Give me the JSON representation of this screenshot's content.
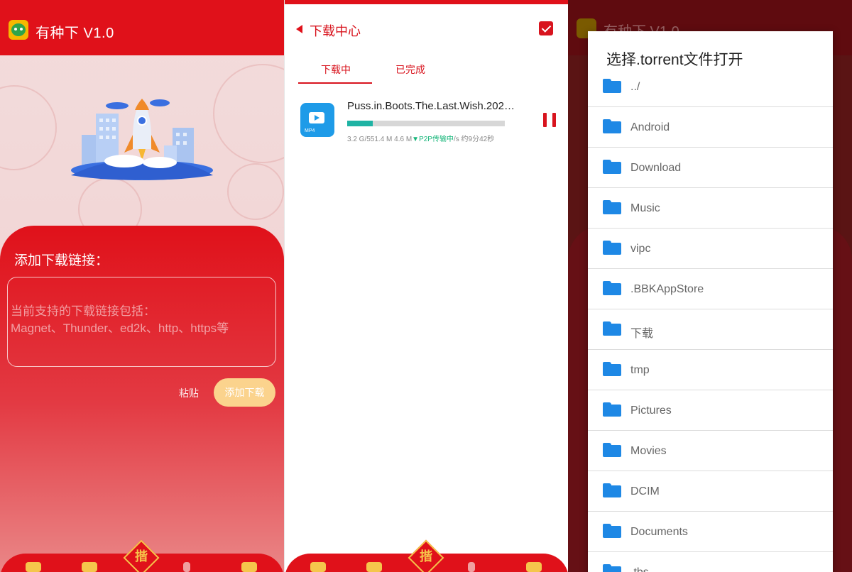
{
  "panel1": {
    "app_title": "有种下 V1.0",
    "card_title": "添加下载链接：",
    "input_placeholder": "当前支持的下载链接包括：\nMagnet、Thunder、ed2k、http、https等",
    "paste_label": "粘贴",
    "add_label": "添加下载",
    "center_badge": "揩"
  },
  "panel2": {
    "title": "下载中心",
    "tabs": [
      {
        "label": "下载中",
        "active": true
      },
      {
        "label": "已完成",
        "active": false
      }
    ],
    "task": {
      "name": "Puss.in.Boots.The.Last.Wish.202…",
      "icon_label": "MP4",
      "progress": 0.16,
      "size_info": "3.2 G/551.4 M",
      "speed": "4.6 M",
      "p2p_label": "▼P2P传输中",
      "remaining": "/s 约9分42秒"
    },
    "center_badge": "揩"
  },
  "panel3": {
    "dimmed_title": "有种下 V1.0",
    "dialog": {
      "title": "选择.torrent文件打开",
      "items": [
        "../",
        "Android",
        "Download",
        "Music",
        "vipc",
        ".BBKAppStore",
        "下载",
        "tmp",
        "Pictures",
        "Movies",
        "DCIM",
        "Documents",
        ".tbs"
      ]
    }
  },
  "colors": {
    "brand_red": "#e0111a",
    "accent_yellow": "#fbd38d",
    "progress": "#1fb3a4",
    "folder_blue": "#1e88e5",
    "p2p_green": "#17b67a"
  }
}
